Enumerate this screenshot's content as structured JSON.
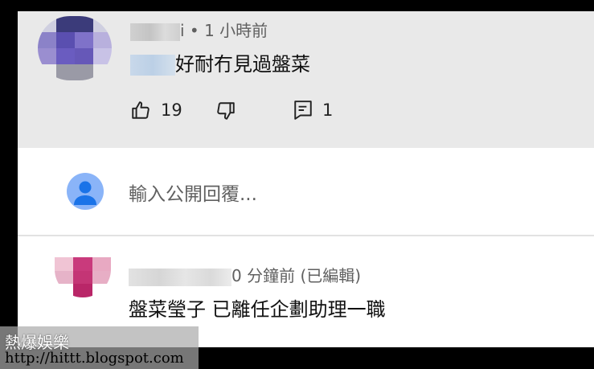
{
  "comment_1": {
    "meta": "i • 1 小時前",
    "text": "好耐冇見過盤菜",
    "likes": "19",
    "replies": "1"
  },
  "reply_box": {
    "placeholder": "輸入公開回覆..."
  },
  "comment_2": {
    "meta": "0 分鐘前 (已編輯)",
    "text": "盤菜瑩子 已離任企劃助理一職"
  },
  "watermark": {
    "line1": "熱爆娛樂",
    "line2": "http://hittt.blogspot.com"
  },
  "icons": {
    "like": "thumbs-up-icon",
    "dislike": "thumbs-down-icon",
    "reply": "reply-icon",
    "user": "person-icon"
  }
}
